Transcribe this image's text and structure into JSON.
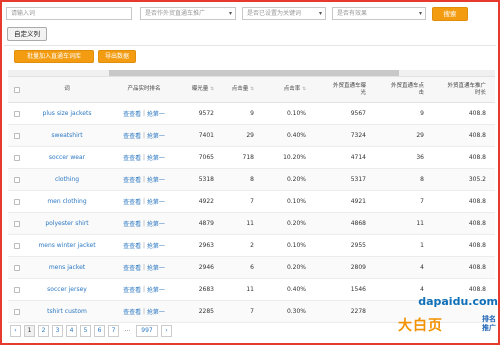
{
  "filters": {
    "search_placeholder": "请输入词",
    "select1": "是否作外贸直通车推广",
    "select2": "是否已设置为关键词",
    "select3": "是否有效果",
    "search_button": "搜索"
  },
  "buttons": {
    "custom_columns": "自定义列",
    "batch_add": "批量加入直通车词库",
    "export": "导出数据"
  },
  "table": {
    "headers": {
      "word": "词",
      "rank": "产品实时排名",
      "impressions": "曝光量",
      "clicks": "点击量",
      "ctr": "点击率",
      "f_impressions": "外贸直通车曝光",
      "f_clicks": "外贸直通车点击",
      "f_duration": "外贸直通车推广时长"
    },
    "rank_view": "查查看",
    "rank_sep": " | ",
    "rank_grab": "抢第一",
    "rows": [
      {
        "word": "plus size jackets",
        "imp": "9572",
        "clk": "9",
        "ctr": "0.10%",
        "fimp": "9567",
        "fclk": "9",
        "fdur": "408.8"
      },
      {
        "word": "sweatshirt",
        "imp": "7401",
        "clk": "29",
        "ctr": "0.40%",
        "fimp": "7324",
        "fclk": "29",
        "fdur": "408.8"
      },
      {
        "word": "soccer wear",
        "imp": "7065",
        "clk": "718",
        "ctr": "10.20%",
        "fimp": "4714",
        "fclk": "36",
        "fdur": "408.8"
      },
      {
        "word": "clothing",
        "imp": "5318",
        "clk": "8",
        "ctr": "0.20%",
        "fimp": "5317",
        "fclk": "8",
        "fdur": "305.2"
      },
      {
        "word": "men clothing",
        "imp": "4922",
        "clk": "7",
        "ctr": "0.10%",
        "fimp": "4921",
        "fclk": "7",
        "fdur": "408.8"
      },
      {
        "word": "polyester shirt",
        "imp": "4879",
        "clk": "11",
        "ctr": "0.20%",
        "fimp": "4868",
        "fclk": "11",
        "fdur": "408.8"
      },
      {
        "word": "mens winter jacket",
        "imp": "2963",
        "clk": "2",
        "ctr": "0.10%",
        "fimp": "2955",
        "fclk": "1",
        "fdur": "408.8"
      },
      {
        "word": "mens jacket",
        "imp": "2946",
        "clk": "6",
        "ctr": "0.20%",
        "fimp": "2809",
        "fclk": "4",
        "fdur": "408.8"
      },
      {
        "word": "soccer jersey",
        "imp": "2683",
        "clk": "11",
        "ctr": "0.40%",
        "fimp": "1546",
        "fclk": "4",
        "fdur": "408.8"
      },
      {
        "word": "tshirt custom",
        "imp": "2285",
        "clk": "7",
        "ctr": "0.30%",
        "fimp": "2278",
        "fclk": "",
        "fdur": ""
      }
    ]
  },
  "pager": {
    "prev": "‹",
    "pages": [
      "1",
      "2",
      "3",
      "4",
      "5",
      "6",
      "7"
    ],
    "dots": "...",
    "last": "997",
    "next": "›",
    "current": "1"
  },
  "watermark": {
    "url": "dapaidu.com",
    "main": "大白页",
    "side": "排名推广"
  },
  "colors": {
    "accent": "#f39c12",
    "link": "#2b78c2",
    "frame": "#e63a2e"
  }
}
